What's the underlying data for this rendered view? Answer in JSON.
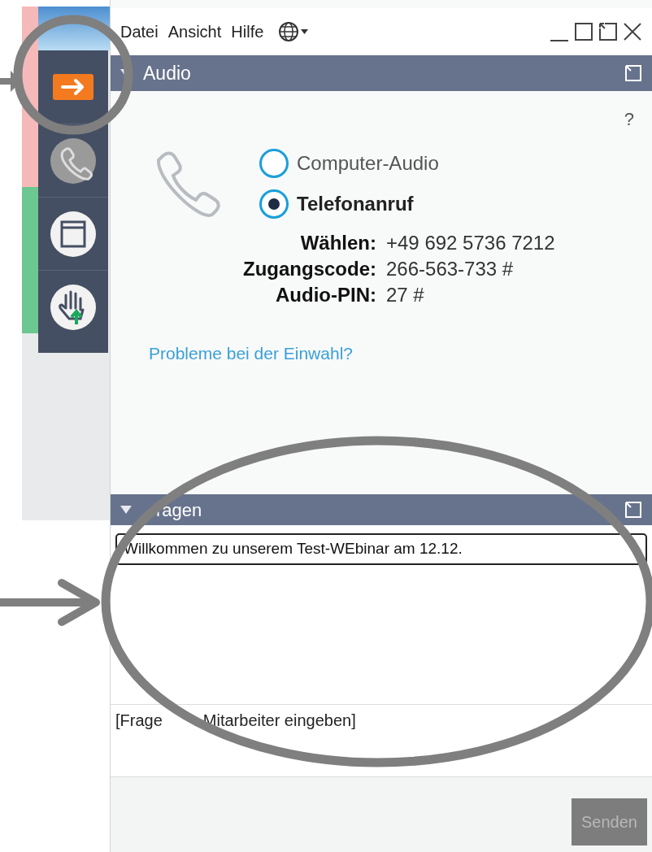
{
  "menu": [
    {
      "label": "Datei"
    },
    {
      "label": "Ansicht"
    },
    {
      "label": "Hilfe"
    }
  ],
  "toolbar": [
    {
      "kind": "arrow"
    },
    {
      "kind": "phone"
    },
    {
      "kind": "window"
    },
    {
      "kind": "hand"
    }
  ],
  "audio": {
    "title": "Audio",
    "expanded": true,
    "help": "?",
    "options": [
      {
        "label": "Computer-Audio",
        "selected": false
      },
      {
        "label": "Telefonanruf",
        "selected": true
      }
    ],
    "details": [
      {
        "label": "Wählen:",
        "value": "+49 692 5736 7212"
      },
      {
        "label": "Zugangscode:",
        "value": "266-563-733 #"
      },
      {
        "label": "Audio-PIN:",
        "value": "27 #"
      }
    ],
    "link": "Probleme bei der Einwahl?"
  },
  "questions": {
    "title": "ragen",
    "expanded": true,
    "messages": [
      "Willkommen zu unserem Test-WEbinar am 12.12."
    ],
    "input": {
      "placeholder_parts": [
        "[Frage",
        "Mitarbeiter eingeben]"
      ]
    },
    "send_button": {
      "label": "Senden",
      "disabled": true
    }
  }
}
